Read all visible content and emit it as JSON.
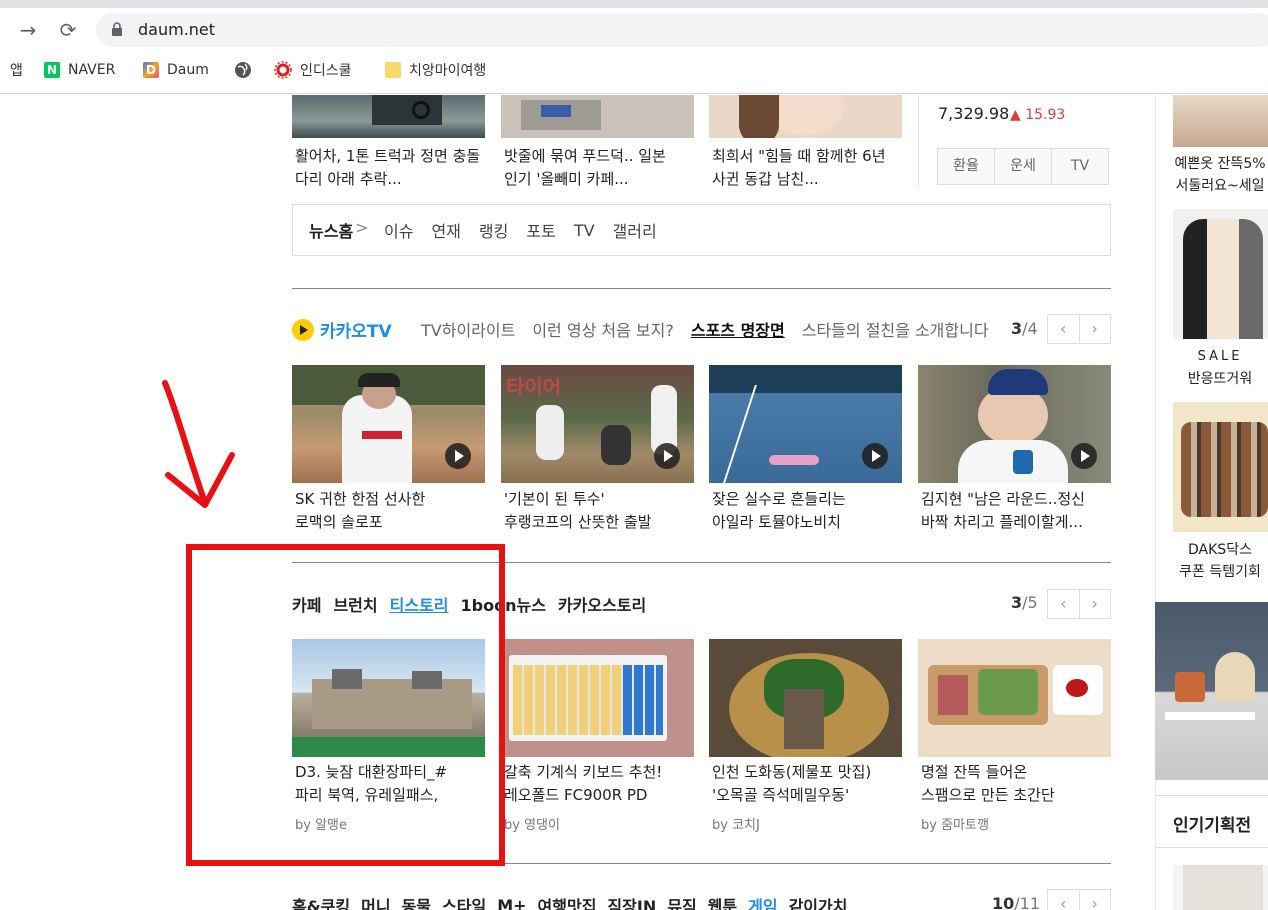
{
  "browser": {
    "url": "daum.net",
    "bookmarks": [
      {
        "label": "앱",
        "icon": "apps-icon"
      },
      {
        "label": "NAVER",
        "icon": "naver-icon"
      },
      {
        "label": "Daum",
        "icon": "daum-icon"
      },
      {
        "label": "",
        "icon": "globe-icon"
      },
      {
        "label": "인디스쿨",
        "icon": "indischool-icon"
      },
      {
        "label": "치앙마이여행",
        "icon": "folder-icon"
      }
    ]
  },
  "top_news": [
    {
      "caption": "활어차, 1톤 트럭과 정면 충돌 다리 아래 추락..."
    },
    {
      "caption": "밧줄에 묶여 푸드덕.. 일본인기 '올빼미 카페..."
    },
    {
      "caption": "최희서 \"힘들 때 함께한 6년 사귄 동갑 남친..."
    }
  ],
  "stock": {
    "value": "7,329.98",
    "change": "▲ 15.93"
  },
  "widget_tabs": [
    "환율",
    "운세",
    "TV"
  ],
  "news_nav": {
    "home": "뉴스홈",
    "arrow": ">",
    "items": [
      "이슈",
      "연재",
      "랭킹",
      "포토",
      "TV",
      "갤러리"
    ]
  },
  "kakaotv": {
    "logo": "카카오TV",
    "tabs": [
      "TV하이라이트",
      "이런 영상 처음 보지?",
      "스포츠 명장면",
      "스타들의 절친을 소개합니다"
    ],
    "active_tab": "스포츠 명장면",
    "page": "3",
    "total": "/4",
    "items": [
      {
        "line1": "SK 귀한 한점 선사한",
        "line2": "로맥의 솔로포"
      },
      {
        "line1": "'기본이 된 투수'",
        "line2": "후랭코프의 산뜻한 출발"
      },
      {
        "line1": "잦은 실수로 흔들리는",
        "line2": "아일라 토뮬야노비치"
      },
      {
        "line1": "김지현 \"남은 라운드..정신",
        "line2": "바짝 차리고 플레이할게..."
      }
    ]
  },
  "cafe": {
    "tabs": [
      "카페",
      "브런치",
      "티스토리",
      "1boon뉴스",
      "카카오스토리"
    ],
    "active_tab": "티스토리",
    "page": "3",
    "total": "/5",
    "items": [
      {
        "line1": "D3. 늦잠 대환장파티_#",
        "line2": "파리 북역, 유레일패스,",
        "by": "by 알맹e"
      },
      {
        "line1": "갈축 기계식 키보드 추천!",
        "line2": "레오폴드 FC900R PD",
        "by": "by 영댕이"
      },
      {
        "line1": "인천 도화동(제물포 맛집)",
        "line2": "'오목골 즉석메밀우동'",
        "by": "by 코치J"
      },
      {
        "line1": "명절 잔뜩 들어온",
        "line2": "스팸으로 만든 초간단",
        "by": "by 줌마토깽"
      }
    ]
  },
  "bottom_nav": {
    "tabs": [
      "홈&쿠킹",
      "머니",
      "동물",
      "스타일",
      "M+",
      "여행맛집",
      "직장IN",
      "뮤직",
      "웹툰",
      "게임",
      "같이가치"
    ],
    "active_tab": "게임",
    "page": "10",
    "total": "/11"
  },
  "sidebar": {
    "items": [
      {
        "line1": "예쁜옷 잔뜩5%",
        "line2": "서둘러요~세일"
      },
      {
        "line1": "SALE",
        "line2": "반응뜨거워"
      },
      {
        "line1": "DAKS닥스",
        "line2": "쿠폰 득템기회"
      }
    ],
    "popular_title": "인기기획전"
  },
  "colors": {
    "accent": "#1e8ce8",
    "annotation": "#e81010",
    "stock_up": "#e03c3c"
  }
}
